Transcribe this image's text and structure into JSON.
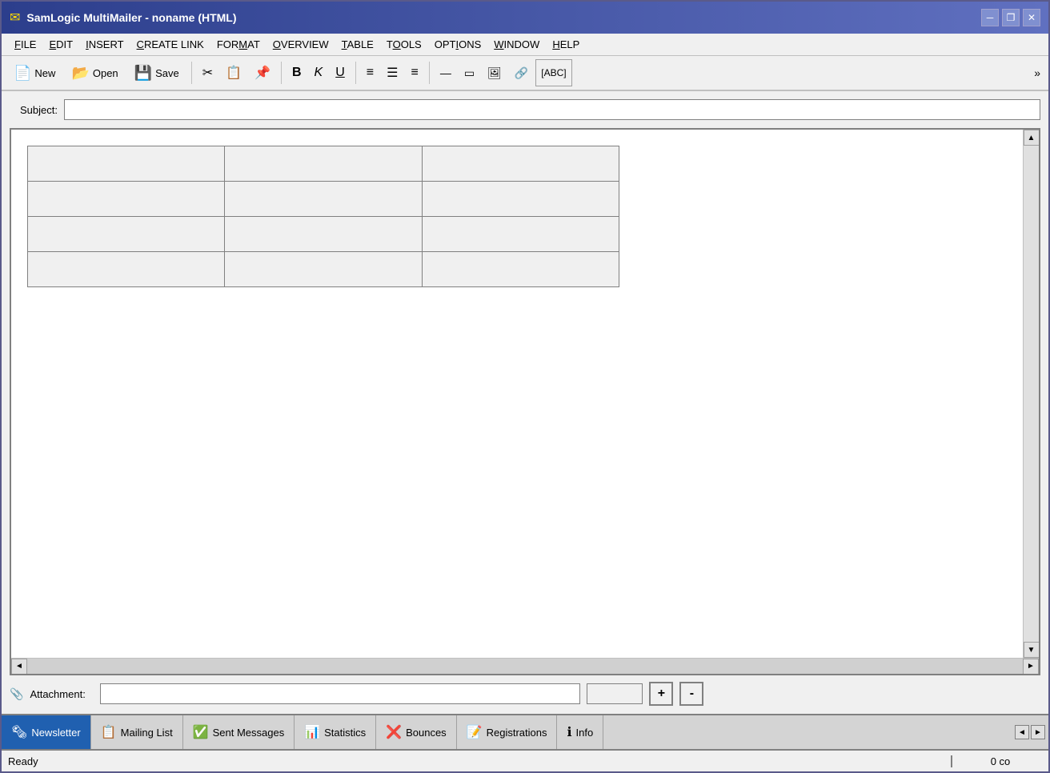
{
  "window": {
    "title": "SamLogic MultiMailer - noname  (HTML)",
    "icon": "✉"
  },
  "titleControls": {
    "minimize": "─",
    "restore": "❐",
    "close": "✕"
  },
  "menu": {
    "items": [
      {
        "label": "FILE",
        "underline": "F"
      },
      {
        "label": "EDIT",
        "underline": "E"
      },
      {
        "label": "INSERT",
        "underline": "I"
      },
      {
        "label": "CREATE LINK",
        "underline": "C"
      },
      {
        "label": "FORMAT",
        "underline": "F"
      },
      {
        "label": "OVERVIEW",
        "underline": "O"
      },
      {
        "label": "TABLE",
        "underline": "T"
      },
      {
        "label": "TOOLS",
        "underline": "T"
      },
      {
        "label": "OPTIONS",
        "underline": "O"
      },
      {
        "label": "WINDOW",
        "underline": "W"
      },
      {
        "label": "HELP",
        "underline": "H"
      }
    ]
  },
  "toolbar": {
    "new_label": "New",
    "open_label": "Open",
    "save_label": "Save",
    "bold_label": "B",
    "italic_label": "K",
    "underline_label": "U"
  },
  "subject": {
    "label": "Subject:",
    "value": "",
    "placeholder": ""
  },
  "attachment": {
    "label": "Attachment:",
    "value": "",
    "plus": "+",
    "minus": "-"
  },
  "tabs": [
    {
      "id": "newsletter",
      "label": "Newsletter",
      "active": true
    },
    {
      "id": "mailing-list",
      "label": "Mailing List",
      "active": false
    },
    {
      "id": "sent-messages",
      "label": "Sent Messages",
      "active": false
    },
    {
      "id": "statistics",
      "label": "Statistics",
      "active": false
    },
    {
      "id": "bounces",
      "label": "Bounces",
      "active": false
    },
    {
      "id": "registrations",
      "label": "Registrations",
      "active": false
    },
    {
      "id": "info",
      "label": "Info",
      "active": false
    }
  ],
  "tabNav": {
    "prev": "◄",
    "next": "►"
  },
  "statusBar": {
    "left": "Ready",
    "right": "0 co"
  },
  "scrollArrows": {
    "up": "▲",
    "down": "▼",
    "left": "◄",
    "right": "►"
  }
}
